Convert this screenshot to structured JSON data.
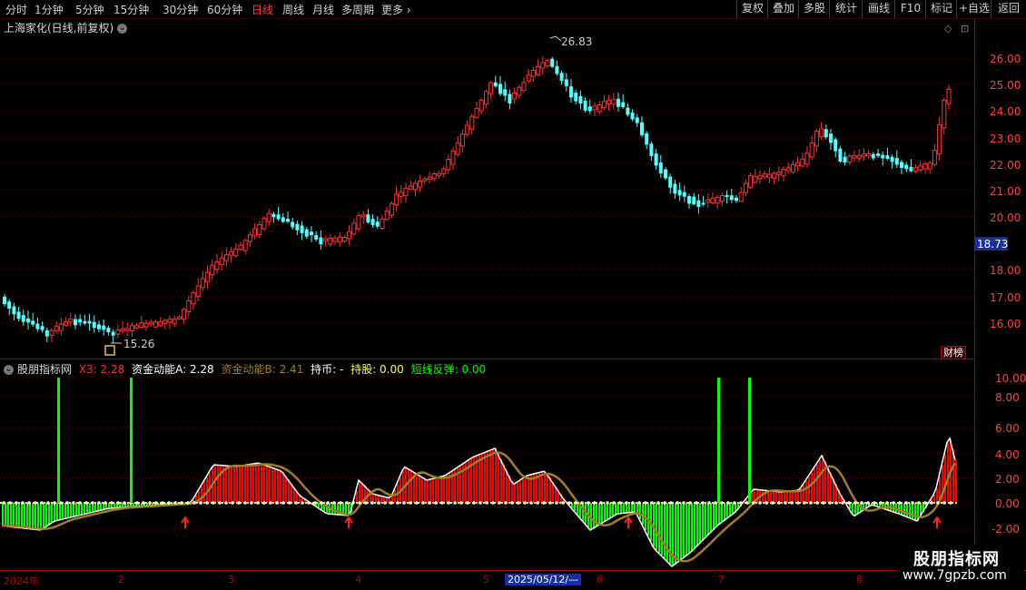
{
  "toolbar": {
    "periods": [
      "分时",
      "1分钟",
      "5分钟",
      "15分钟",
      "30分钟",
      "60分钟",
      "日线",
      "周线",
      "月线",
      "多周期",
      "更多"
    ],
    "active": "日线",
    "right_buttons": [
      "复权",
      "叠加",
      "多股",
      "统计",
      "画线",
      "F10",
      "标记",
      "+自选",
      "返回"
    ]
  },
  "stock": {
    "name": "上海家化(日线,前复权)",
    "collapse_icon": "chevron-down-icon"
  },
  "price_axis": {
    "labels": [
      "26.00",
      "25.00",
      "24.00",
      "23.00",
      "22.00",
      "21.00",
      "20.00",
      "18.00",
      "17.00",
      "16.00"
    ],
    "current": "18.73"
  },
  "annotations": {
    "high": "26.83",
    "low": "15.26"
  },
  "main_badge": "财榜",
  "indicator": {
    "name": "股朋指标网",
    "x3": "X3: 2.28",
    "a": "资金动能A: 2.28",
    "b": "资金动能B: 2.41",
    "hold_coin": "持币: -",
    "hold_stock": "持股: 0.00",
    "rebound": "短线反弹: 0.00",
    "axis": [
      "10.00",
      "8.00",
      "6.00",
      "4.00",
      "2.00",
      "0.00",
      "-2.00"
    ]
  },
  "dates": {
    "items": [
      "2024年",
      "2",
      "3",
      "4",
      "5",
      "2025/05/12/—",
      "6",
      "7",
      "8"
    ]
  },
  "watermark": {
    "line1": "股朋指标网",
    "line2": "www.7gpzb.com"
  },
  "colors": {
    "up": "#ff3232",
    "down": "#54ffff",
    "grid": "#800000",
    "bar_red": "#ff0000",
    "bar_green": "#00ff00",
    "line": "#a08020"
  }
}
